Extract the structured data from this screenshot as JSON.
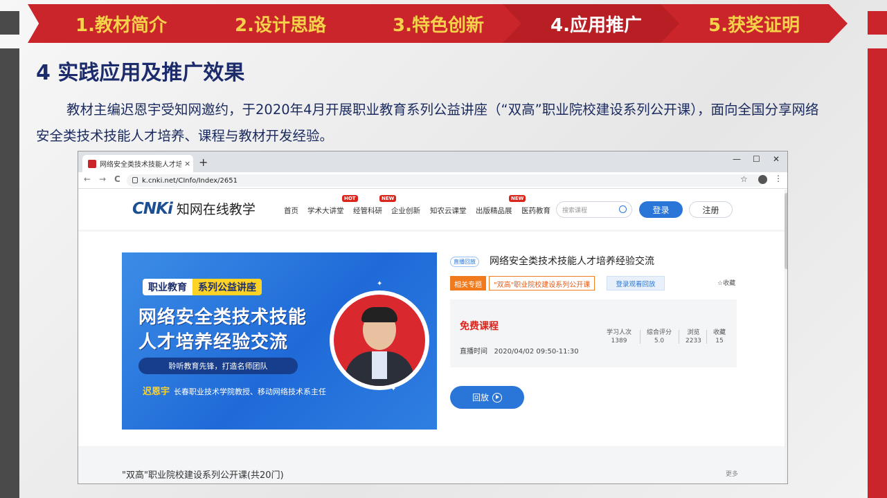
{
  "slide": {
    "nav": [
      "1.教材简介",
      "2.设计思路",
      "3.特色创新",
      "4.应用推广",
      "5.获奖证明"
    ],
    "active_nav": 3,
    "heading": "4 实践应用及推广效果",
    "paragraph": "教材主编迟恩宇受知网邀约，于2020年4月开展职业教育系列公益讲座（“双高”职业院校建设系列公开课），面向全国分享网络安全类技术技能人才培养、课程与教材开发经验。"
  },
  "browser": {
    "tab_title": "网络安全类技术技能人才培养经验交流",
    "tab_close": "×",
    "new_tab": "+",
    "win_min": "—",
    "win_max": "☐",
    "win_close": "✕",
    "back": "←",
    "forward": "→",
    "reload": "C",
    "url": "k.cnki.net/CInfo/Index/2651",
    "bookmark_star": "☆",
    "kebab": "⋮"
  },
  "site": {
    "logo_mark": "CNKi",
    "logo_text": "知网在线教学",
    "menu": [
      "首页",
      "学术大讲堂",
      "经管科研",
      "企业创新",
      "知农云课堂",
      "出版精品展",
      "医药教育"
    ],
    "badges": {
      "hot": "HOT",
      "new": "NEW"
    },
    "search_placeholder": "搜索课程",
    "login": "登录",
    "register": "注册"
  },
  "banner": {
    "tag1": "职业教育",
    "tag2": "系列公益讲座",
    "title_line1": "网络安全类技术技能",
    "title_line2": "人才培养经验交流",
    "slogan": "聆听教育先锋，打造名师团队",
    "speaker": "迟恩宇",
    "speaker_desc": "长春职业技术学院教授、移动网络技术系主任"
  },
  "course": {
    "live_tag": "直播回放",
    "title": "网络安全类技术技能人才培养经验交流",
    "related_label": "相关专题",
    "related_topic": "\"双高\"职业院校建设系列公开课",
    "login_replay": "登录观看回放",
    "favorite": "☆收藏",
    "free": "免费课程",
    "time_label": "直播时间",
    "time_value": "2020/04/02 09:50-11:30",
    "stats": [
      {
        "label": "学习人次",
        "value": "1389"
      },
      {
        "label": "综合评分",
        "value": "5.0"
      },
      {
        "label": "浏览",
        "value": "2233"
      },
      {
        "label": "收藏",
        "value": "15"
      }
    ],
    "replay_button": "回放"
  },
  "series": {
    "title": "\"双高\"职业院校建设系列公开课(共20门)",
    "more": "更多"
  },
  "colors": {
    "brand_red": "#c9252a",
    "nav_yellow": "#f6d24a",
    "heading_blue": "#1c2b6b",
    "accent_blue": "#2a76d8"
  }
}
